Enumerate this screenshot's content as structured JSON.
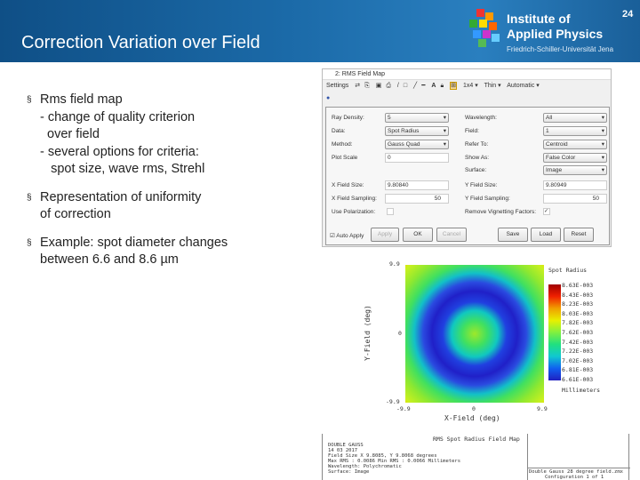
{
  "slide": {
    "title": "Correction Variation over Field",
    "page_number": "24",
    "institute": [
      "Institute of",
      "Applied Physics"
    ],
    "university": "Friedrich-Schiller-Universität Jena",
    "bullets": [
      {
        "lines": [
          "Rms field map",
          "- change of quality criterion",
          "  over field",
          "- several options for criteria:",
          "   spot size, wave rms, Strehl"
        ]
      },
      {
        "lines": [
          "Representation of uniformity",
          "of correction"
        ]
      },
      {
        "lines": [
          "Example: spot diameter changes",
          "between 6.6  and 8.6 µm"
        ]
      }
    ]
  },
  "window": {
    "title": "2: RMS Field Map",
    "toolbar": {
      "settings": "Settings",
      "layout": "1x4 ▾",
      "line": "Thin ▾",
      "scale": "Automatic ▾"
    },
    "fields": {
      "ray_density_label": "Ray Density:",
      "ray_density": "5",
      "data_label": "Data:",
      "data": "Spot Radius",
      "method_label": "Method:",
      "method": "Gauss Quad",
      "plot_scale_label": "Plot Scale",
      "plot_scale": "0",
      "wavelength_label": "Wavelength:",
      "wavelength": "All",
      "field_label": "Field:",
      "field": "1",
      "refer_label": "Refer To:",
      "refer": "Centroid",
      "show_label": "Show As:",
      "show": "False Color",
      "surface_label": "Surface:",
      "surface": "Image",
      "xsize_label": "X Field Size:",
      "xsize": "9.80840",
      "ysize_label": "Y Field Size:",
      "ysize": "9.80949",
      "xsamp_label": "X Field Sampling:",
      "xsamp": "50",
      "ysamp_label": "Y Field Sampling:",
      "ysamp": "50",
      "polar_label": "Use Polarization:",
      "vignet_label": "Remove Vignetting Factors:"
    },
    "buttons": {
      "auto_apply": "Auto Apply",
      "apply": "Apply",
      "ok": "OK",
      "cancel": "Cancel",
      "save": "Save",
      "load": "Load",
      "reset": "Reset"
    }
  },
  "plot": {
    "y_top": "9.9",
    "y_mid": "0",
    "y_bot": "-9.9",
    "x_left": "-9.9",
    "x_mid": "0",
    "x_right": "9.9",
    "xlabel": "X-Field (deg)",
    "ylabel": "Y-Field (deg)",
    "legend_title": "Spot Radius",
    "units": "Millimeters",
    "colorbar": [
      "8.63E-003",
      "8.43E-003",
      "8.23E-003",
      "8.03E-003",
      "7.82E-003",
      "7.62E-003",
      "7.42E-003",
      "7.22E-003",
      "7.02E-003",
      "6.81E-003",
      "6.61E-003"
    ],
    "footer_title": "RMS Spot Radius Field Map",
    "footer_lines": [
      "DOUBLE GAUSS",
      "14 03 2017",
      "Field Size X   9.8085, Y   9.8068 degrees",
      "Max RMS : 0.0086  Min RMS : 0.0066 Millimeters",
      "Wavelength: Polychromatic",
      "Surface: Image"
    ],
    "file": "Double Gauss 28 degree field.zmx",
    "config": "Configuration 1 of 1"
  }
}
